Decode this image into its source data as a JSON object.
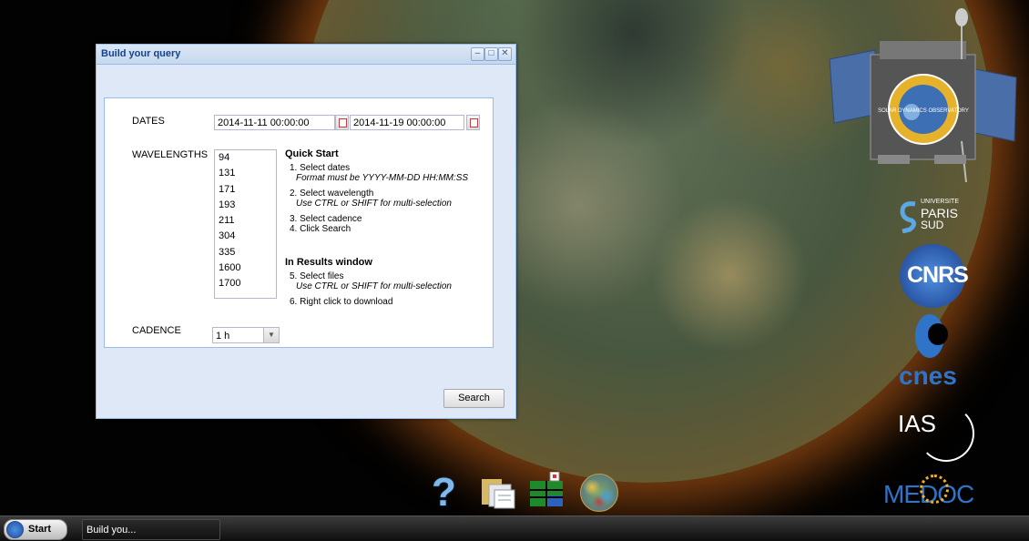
{
  "window": {
    "title": "Build your query",
    "buttons": {
      "minimize": "–",
      "maximize": "□",
      "close": "✕"
    }
  },
  "form": {
    "dates_label": "DATES",
    "date_start": "2014-11-11 00:00:00",
    "date_end": "2014-11-19 00:00:00",
    "wavelengths_label": "WAVELENGTHS",
    "wavelengths": [
      "94",
      "131",
      "171",
      "193",
      "211",
      "304",
      "335",
      "1600",
      "1700"
    ],
    "cadence_label": "CADENCE",
    "cadence_value": "1 h"
  },
  "quick_start": {
    "heading": "Quick Start",
    "step1": "1. Select dates",
    "step1_note": "Format must be YYYY-MM-DD HH:MM:SS",
    "step2": "2. Select wavelength",
    "step2_note": "Use CTRL or SHIFT for multi-selection",
    "step3": "3. Select cadence",
    "step4": "4. Click Search",
    "results_heading": "In Results window",
    "step5": "5. Select files",
    "step5_note": "Use CTRL or SHIFT for multi-selection",
    "step6": "6. Right click to download"
  },
  "search_button": "Search",
  "logos": {
    "satellite_badge": "SOLAR DYNAMICS OBSERVATORY",
    "paris_sud_top": "UNIVERSITE",
    "paris_sud_mid": "PARIS",
    "paris_sud_bot": "SUD",
    "cnrs": "CNRS",
    "cnes": "cnes",
    "ias": "IAS",
    "medoc": "MEDOC"
  },
  "dock": [
    "help-icon",
    "folder-icon",
    "grid-icon",
    "globe-icon"
  ],
  "taskbar": {
    "start_label": "Start",
    "task_label": "Build you..."
  },
  "colors": {
    "window_header": "#c7d8ee",
    "window_title": "#15428b",
    "taskbar": "#1e1e1e"
  }
}
